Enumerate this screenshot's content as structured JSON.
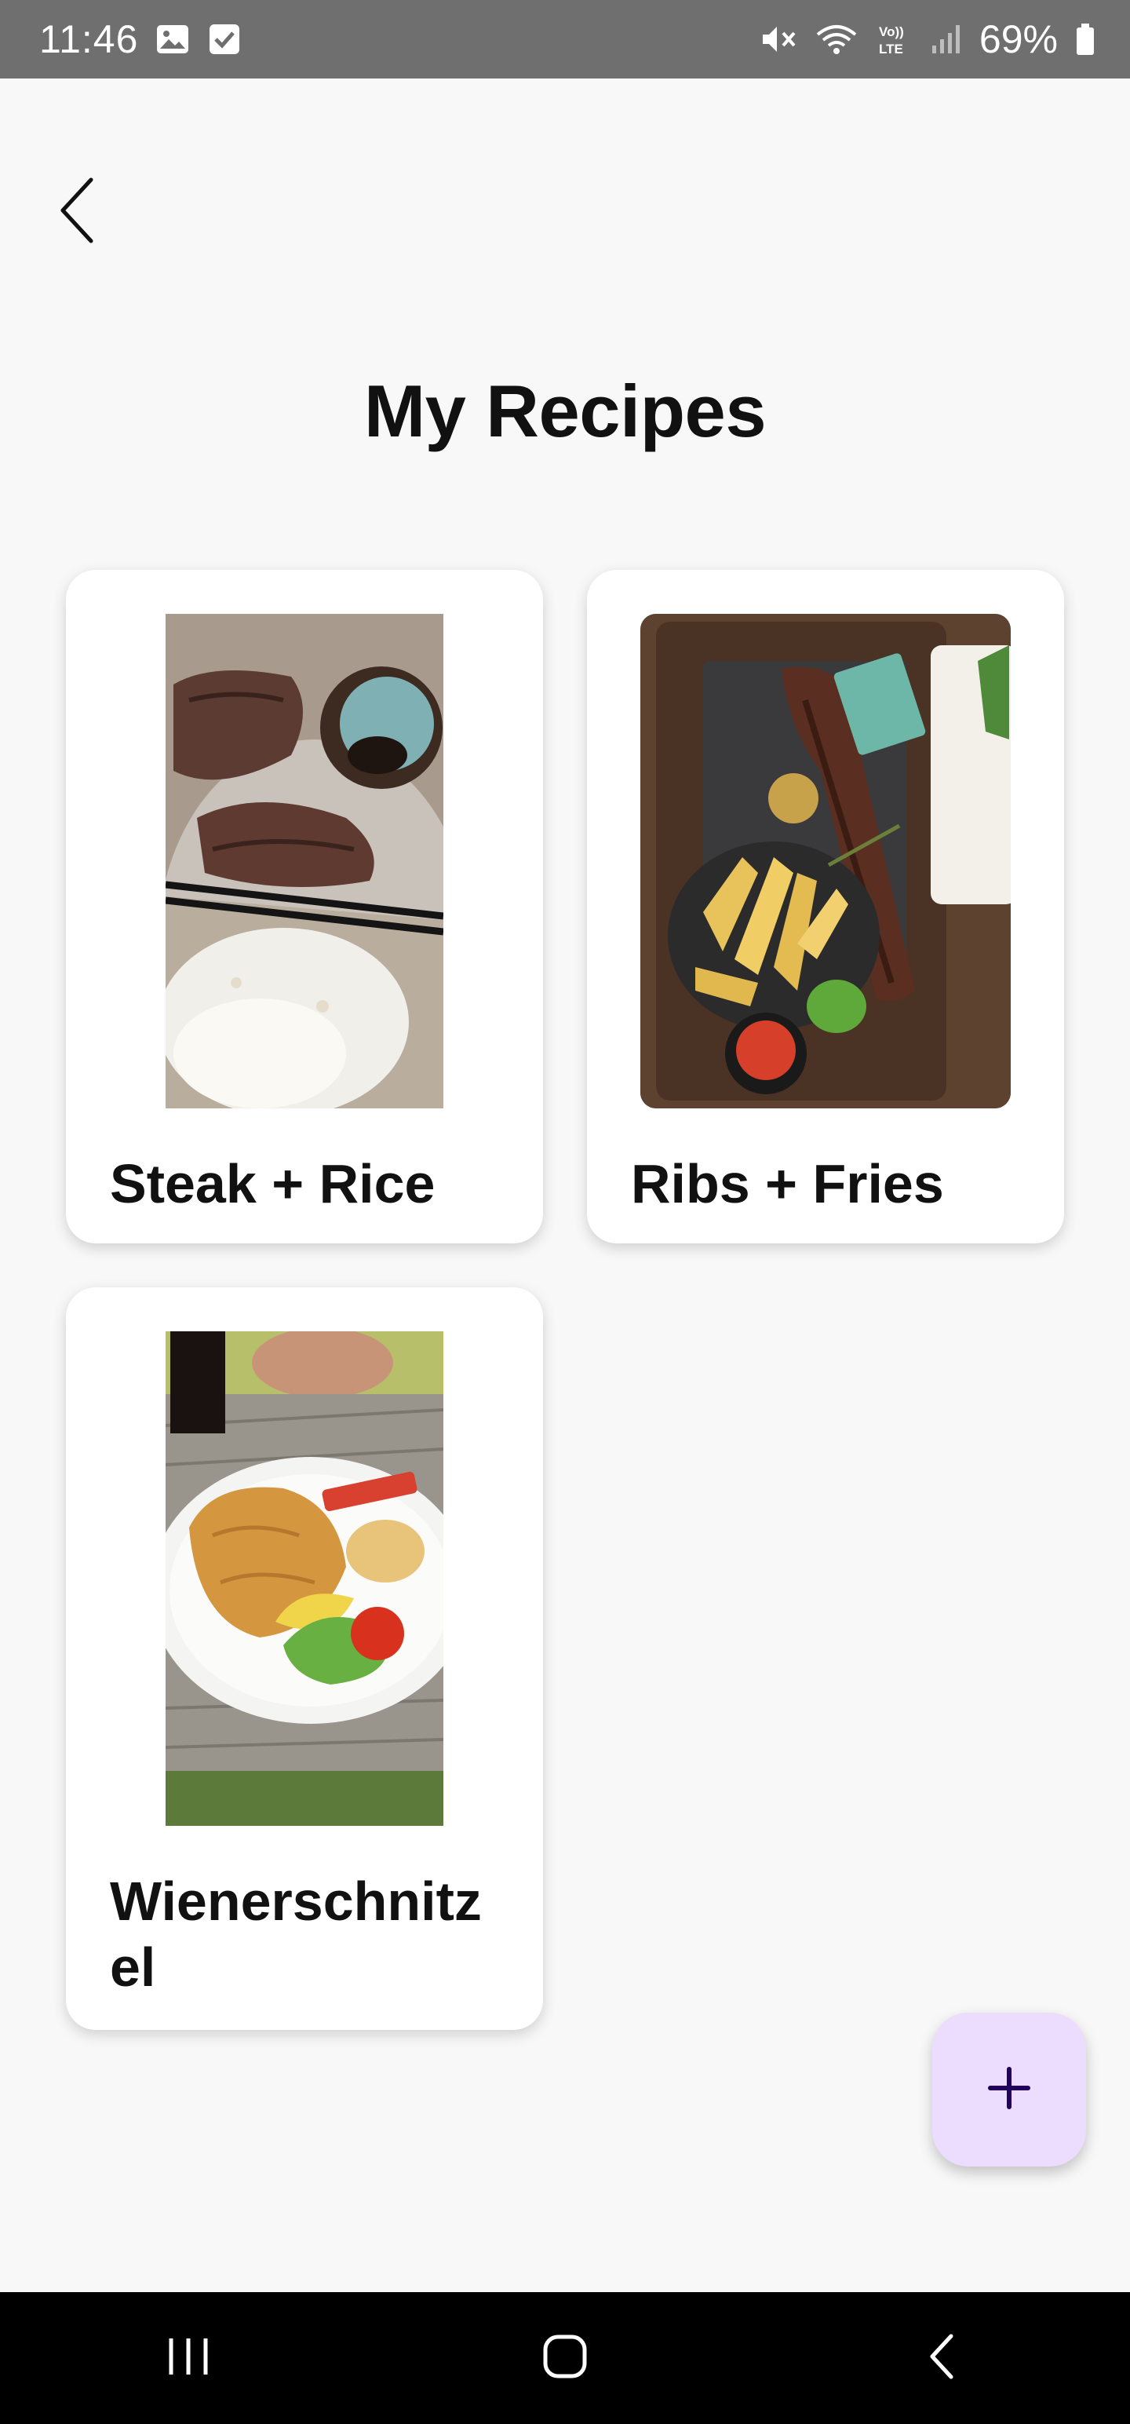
{
  "status_bar": {
    "time": "11:46",
    "battery": "69%",
    "left_icons": [
      "image-icon",
      "checkbox-icon"
    ],
    "right_icons": [
      "mute-icon",
      "wifi-icon",
      "volte-icon",
      "signal-icon",
      "battery-icon"
    ]
  },
  "header": {
    "back_icon": "chevron-left-icon",
    "title": "My Recipes"
  },
  "recipes": [
    {
      "name": "Steak + Rice"
    },
    {
      "name": "Ribs + Fries"
    },
    {
      "name": "Wienerschnitzel"
    }
  ],
  "fab": {
    "icon": "plus-icon",
    "color": "#ecdcfd",
    "icon_color": "#21005d"
  },
  "nav_bar": {
    "buttons": [
      "recents-icon",
      "home-icon",
      "back-icon"
    ]
  }
}
